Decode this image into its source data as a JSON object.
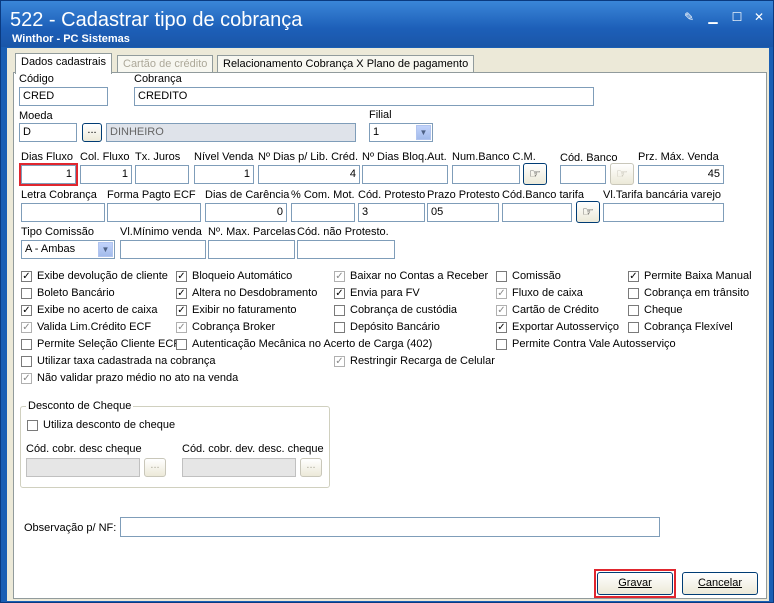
{
  "window": {
    "title": "522 - Cadastrar tipo de cobrança",
    "subtitle": "Winthor - PC Sistemas"
  },
  "tabs": [
    "Dados cadastrais",
    "Cartão de crédito",
    "Relacionamento Cobrança X Plano de pagamento"
  ],
  "fields": {
    "codigo": {
      "label": "Código",
      "value": "CRED"
    },
    "cobranca": {
      "label": "Cobrança",
      "value": "CREDITO"
    },
    "moeda": {
      "label": "Moeda",
      "value": "D",
      "desc": "DINHEIRO"
    },
    "filial": {
      "label": "Filial",
      "value": "1"
    },
    "dias_fluxo": {
      "label": "Dias Fluxo",
      "value": "1"
    },
    "col_fluxo": {
      "label": "Col. Fluxo",
      "value": "1"
    },
    "tx_juros": {
      "label": "Tx. Juros",
      "value": ""
    },
    "nivel_venda": {
      "label": "Nível Venda",
      "value": "1"
    },
    "dias_lib_cred": {
      "label": "Nº Dias p/ Lib. Créd.",
      "value": "4"
    },
    "dias_bloq_aut": {
      "label": "Nº Dias Bloq.Aut.",
      "value": ""
    },
    "num_banco_cm": {
      "label": "Num.Banco C.M.",
      "value": ""
    },
    "cod_banco": {
      "label": "Cód. Banco",
      "value": ""
    },
    "prz_max_venda": {
      "label": "Prz. Máx. Venda",
      "value": "45"
    },
    "letra_cobranca": {
      "label": "Letra Cobrança",
      "value": ""
    },
    "forma_pagto_ecf": {
      "label": "Forma Pagto ECF",
      "value": ""
    },
    "dias_carencia": {
      "label": "Dias de Carência",
      "value": "0"
    },
    "com_mot": {
      "label": "% Com. Mot.",
      "value": ""
    },
    "cod_protesto": {
      "label": "Cód. Protesto",
      "value": "3"
    },
    "prazo_protesto": {
      "label": "Prazo Protesto",
      "value": "05"
    },
    "cod_banco_tarifa": {
      "label": "Cód.Banco tarifa",
      "value": ""
    },
    "vl_tarifa": {
      "label": "Vl.Tarifa bancária varejo",
      "value": ""
    },
    "tipo_comissao": {
      "label": "Tipo Comissão",
      "value": "A - Ambas"
    },
    "vl_minimo_venda": {
      "label": "Vl.Mínimo venda",
      "value": ""
    },
    "max_parcelas": {
      "label": "Nº. Max. Parcelas",
      "value": ""
    },
    "cod_nao_protesto": {
      "label": "Cód. não  Protesto.",
      "value": ""
    }
  },
  "checkboxes": {
    "col1": [
      {
        "label": "Exibe devolução de cliente",
        "checked": true,
        "disabled": false
      },
      {
        "label": "Boleto Bancário",
        "checked": false,
        "disabled": false
      },
      {
        "label": "Exibe no acerto de caixa",
        "checked": true,
        "disabled": false
      },
      {
        "label": "Valida Lim.Crédito ECF",
        "checked": true,
        "disabled": true
      },
      {
        "label": "Permite Seleção Cliente ECF",
        "checked": false,
        "disabled": false
      },
      {
        "label": "Utilizar taxa cadastrada na cobrança",
        "checked": false,
        "disabled": false
      },
      {
        "label": "Não validar prazo médio no ato na venda",
        "checked": true,
        "disabled": true
      }
    ],
    "col2": [
      {
        "label": "Bloqueio Automático",
        "checked": true,
        "disabled": false
      },
      {
        "label": "Altera no Desdobramento",
        "checked": true,
        "disabled": false
      },
      {
        "label": "Exibir no faturamento",
        "checked": true,
        "disabled": false
      },
      {
        "label": "Cobrança Broker",
        "checked": true,
        "disabled": true
      },
      {
        "label": "Autenticação Mecânica no Acerto de Carga (402)",
        "checked": false,
        "disabled": false
      }
    ],
    "col3": [
      {
        "label": "Baixar no Contas a Receber",
        "checked": true,
        "disabled": true
      },
      {
        "label": "Envia para FV",
        "checked": true,
        "disabled": false
      },
      {
        "label": "Cobrança de custódia",
        "checked": false,
        "disabled": false
      },
      {
        "label": "Depósito Bancário",
        "checked": false,
        "disabled": false
      },
      {
        "label": "Restringir Recarga de Celular",
        "checked": true,
        "disabled": true
      }
    ],
    "col4": [
      {
        "label": "Comissão",
        "checked": false,
        "disabled": false
      },
      {
        "label": "Fluxo de caixa",
        "checked": true,
        "disabled": true
      },
      {
        "label": "Cartão de Crédito",
        "checked": true,
        "disabled": true
      },
      {
        "label": "Exportar Autosserviço",
        "checked": true,
        "disabled": false
      },
      {
        "label": "Permite Contra Vale Autosserviço",
        "checked": false,
        "disabled": false
      }
    ],
    "col5": [
      {
        "label": "Permite Baixa Manual",
        "checked": true,
        "disabled": false
      },
      {
        "label": "Cobrança em trânsito",
        "checked": false,
        "disabled": false
      },
      {
        "label": "Cheque",
        "checked": false,
        "disabled": false
      },
      {
        "label": "Cobrança Flexível",
        "checked": false,
        "disabled": false
      }
    ]
  },
  "desconto_cheque": {
    "title": "Desconto de Cheque",
    "utilizar": "Utiliza desconto de cheque",
    "cod_desc_label": "Cód. cobr. desc cheque",
    "cod_dev_label": "Cód. cobr. dev. desc. cheque"
  },
  "observacao": {
    "label": "Observação p/ NF:",
    "value": ""
  },
  "buttons": {
    "gravar": "Gravar",
    "cancelar": "Cancelar",
    "browse": "...",
    "find": "☞"
  },
  "colors": {
    "title_bg": "#1d5fb8",
    "form_bg": "#ece9d8",
    "highlight": "#e0262e"
  }
}
